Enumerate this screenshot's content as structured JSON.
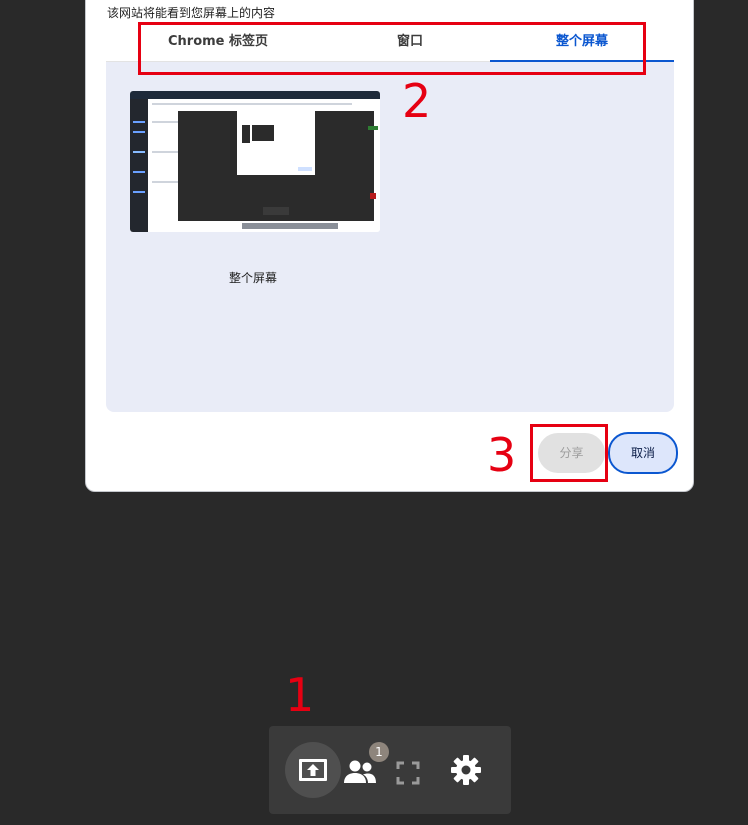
{
  "dialog": {
    "description": "该网站将能看到您屏幕上的内容",
    "tabs": [
      {
        "label": "Chrome 标签页",
        "selected": false
      },
      {
        "label": "窗口",
        "selected": false
      },
      {
        "label": "整个屏幕",
        "selected": true
      }
    ],
    "source": {
      "label": "整个屏幕"
    },
    "share_label": "分享",
    "cancel_label": "取消"
  },
  "annotations": {
    "step1": "1",
    "step2": "2",
    "step3": "3"
  },
  "toolbar": {
    "participants_count": "1",
    "items": [
      "present-screen-icon",
      "participants-icon",
      "fullscreen-icon",
      "gear-icon"
    ]
  },
  "colors": {
    "background": "#292929",
    "accent": "#0b57d0",
    "annotation": "#e60012",
    "panel": "#e9ecf7"
  }
}
